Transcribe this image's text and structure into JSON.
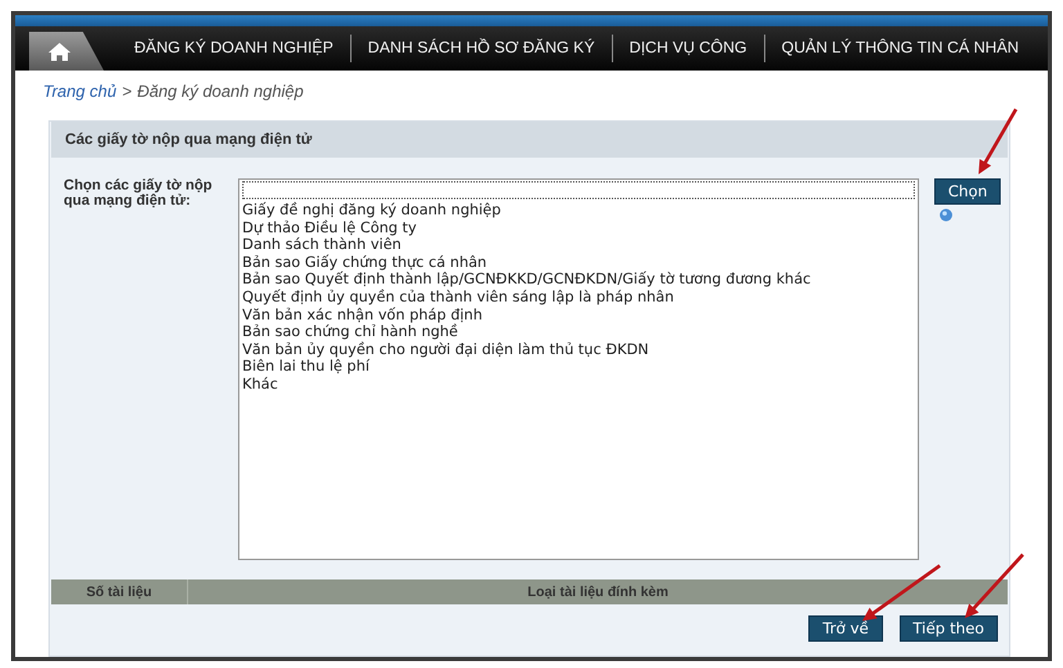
{
  "nav": {
    "items": [
      {
        "label": "ĐĂNG KÝ DOANH NGHIỆP",
        "selected": false
      },
      {
        "label": "DANH SÁCH HỒ SƠ ĐĂNG KÝ",
        "selected": false
      },
      {
        "label": "DỊCH VỤ CÔNG",
        "selected": false
      },
      {
        "label": "QUẢN LÝ THÔNG TIN CÁ NHÂN",
        "selected": false
      }
    ]
  },
  "breadcrumb": {
    "link": "Trang chủ",
    "separator": ">",
    "current": "Đăng ký doanh nghiệp"
  },
  "panel": {
    "title": "Các giấy tờ nộp qua mạng điện tử",
    "field_label": "Chọn các giấy tờ nộp qua mạng điện tử:",
    "options": [
      {
        "label": "Giấy đề nghị đăng ký doanh nghiệp",
        "selected": false
      },
      {
        "label": "Dự thảo Điều lệ Công ty",
        "selected": false
      },
      {
        "label": "Danh sách thành viên",
        "selected": false
      },
      {
        "label": "Bản sao Giấy chứng thực cá nhân",
        "selected": false
      },
      {
        "label": "Bản sao Quyết định thành lập/GCNĐKKD/GCNĐKDN/Giấy tờ tương đương khác",
        "selected": false
      },
      {
        "label": "Quyết định ủy quyền của thành viên sáng lập là pháp nhân",
        "selected": false
      },
      {
        "label": "Văn bản xác nhận vốn pháp định",
        "selected": false
      },
      {
        "label": "Bản sao chứng chỉ hành nghề",
        "selected": false
      },
      {
        "label": "Văn bản ủy quyền cho người đại diện làm thủ tục ĐKDN",
        "selected": false
      },
      {
        "label": "Biên lai thu lệ phí",
        "selected": false
      },
      {
        "label": "Khác",
        "selected": false
      }
    ],
    "choose_button": "Chọn",
    "table": {
      "columns": [
        "Số tài liệu",
        "Loại tài liệu đính kèm"
      ]
    },
    "buttons": [
      "Trở về",
      "Tiếp theo"
    ]
  }
}
